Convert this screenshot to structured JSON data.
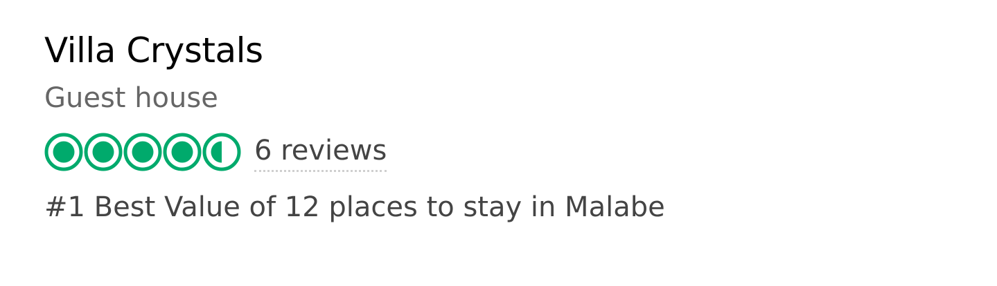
{
  "listing": {
    "name": "Villa Crystals",
    "type": "Guest house",
    "rating": {
      "value": 4.5,
      "max": 5,
      "color": "#00aa6c",
      "icon": "rating-bubble-icon"
    },
    "reviews_label": "6 reviews",
    "rank_text": "#1 Best Value of 12 places to stay in Malabe"
  }
}
